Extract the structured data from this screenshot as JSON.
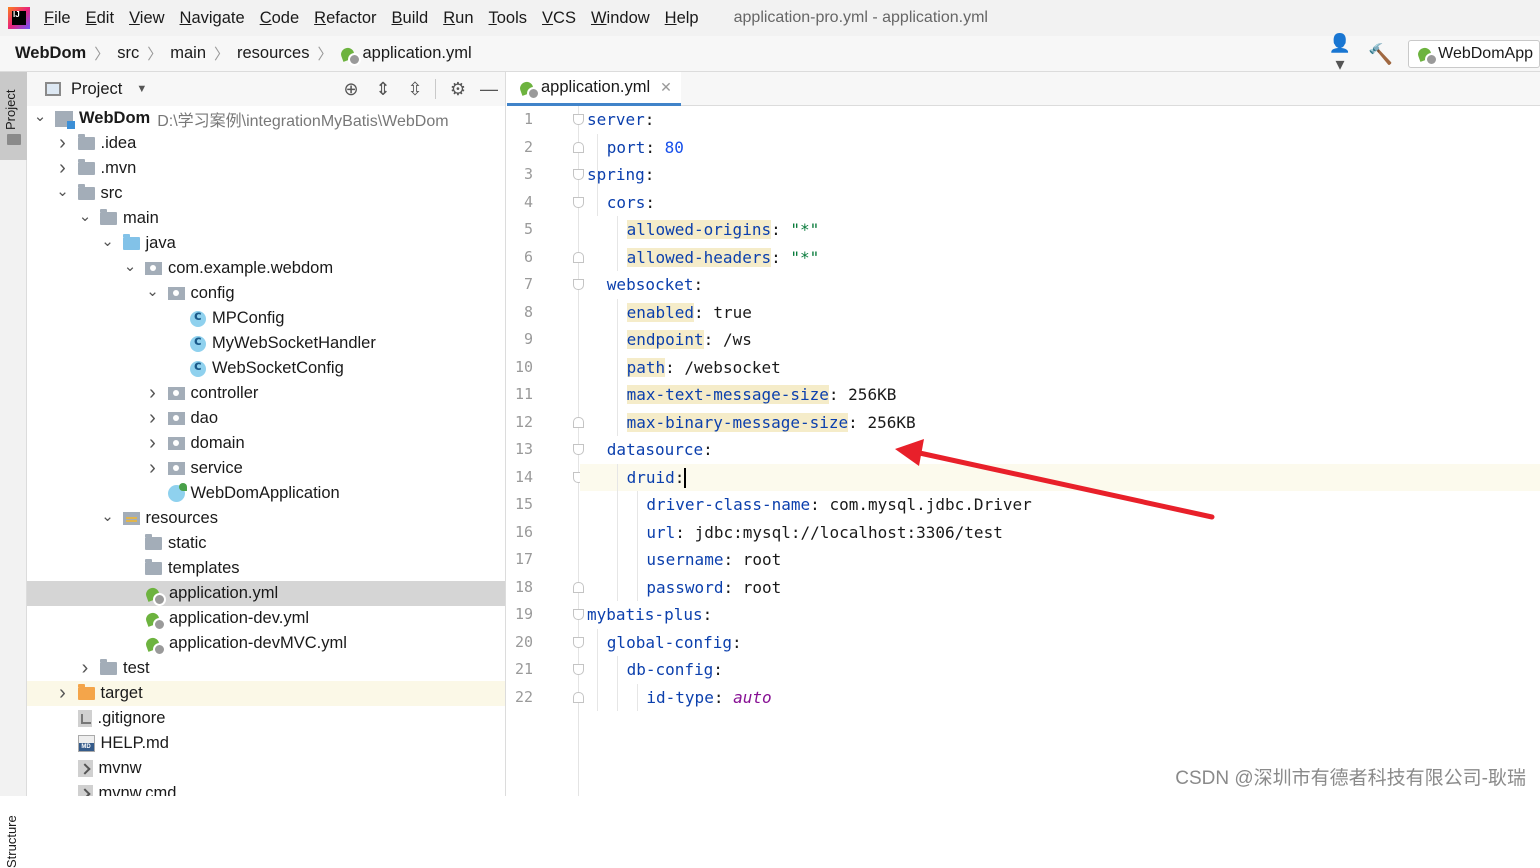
{
  "menubar": {
    "items": [
      {
        "first": "F",
        "rest": "ile"
      },
      {
        "first": "E",
        "rest": "dit"
      },
      {
        "first": "V",
        "rest": "iew"
      },
      {
        "first": "N",
        "rest": "avigate"
      },
      {
        "first": "C",
        "rest": "ode"
      },
      {
        "first": "R",
        "rest": "efactor"
      },
      {
        "first": "B",
        "rest": "uild"
      },
      {
        "first": "R",
        "rest": "un"
      },
      {
        "first": "T",
        "rest": "ools"
      },
      {
        "first": "V",
        "rest": "CS"
      },
      {
        "first": "W",
        "rest": "indow"
      },
      {
        "first": "H",
        "rest": "elp"
      }
    ],
    "window_title": "application-pro.yml - application.yml"
  },
  "breadcrumb": [
    "WebDom",
    "src",
    "main",
    "resources",
    "application.yml"
  ],
  "run_config": "WebDomApp",
  "project_panel": {
    "title": "Project",
    "tools": [
      "crosshair-icon",
      "expand-all-icon",
      "collapse-all-icon",
      "gear-icon",
      "minimize-icon"
    ]
  },
  "tree": [
    {
      "depth": 0,
      "arrow": "down",
      "icon": "module",
      "label": "WebDom",
      "path": "D:\\学习案例\\integrationMyBatis\\WebDom",
      "bold": true
    },
    {
      "depth": 1,
      "arrow": "right",
      "icon": "folder",
      "label": ".idea"
    },
    {
      "depth": 1,
      "arrow": "right",
      "icon": "folder",
      "label": ".mvn"
    },
    {
      "depth": 1,
      "arrow": "down",
      "icon": "folder",
      "label": "src"
    },
    {
      "depth": 2,
      "arrow": "down",
      "icon": "folder",
      "label": "main"
    },
    {
      "depth": 3,
      "arrow": "down",
      "icon": "folder-blue",
      "label": "java"
    },
    {
      "depth": 4,
      "arrow": "down",
      "icon": "package",
      "label": "com.example.webdom"
    },
    {
      "depth": 5,
      "arrow": "down",
      "icon": "package",
      "label": "config"
    },
    {
      "depth": 6,
      "arrow": "none",
      "icon": "class",
      "label": "MPConfig"
    },
    {
      "depth": 6,
      "arrow": "none",
      "icon": "class",
      "label": "MyWebSocketHandler"
    },
    {
      "depth": 6,
      "arrow": "none",
      "icon": "class",
      "label": "WebSocketConfig"
    },
    {
      "depth": 5,
      "arrow": "right",
      "icon": "package",
      "label": "controller"
    },
    {
      "depth": 5,
      "arrow": "right",
      "icon": "package",
      "label": "dao"
    },
    {
      "depth": 5,
      "arrow": "right",
      "icon": "package",
      "label": "domain"
    },
    {
      "depth": 5,
      "arrow": "right",
      "icon": "package",
      "label": "service"
    },
    {
      "depth": 5,
      "arrow": "none",
      "icon": "appclass",
      "label": "WebDomApplication"
    },
    {
      "depth": 3,
      "arrow": "down",
      "icon": "resources",
      "label": "resources"
    },
    {
      "depth": 4,
      "arrow": "none",
      "icon": "folder",
      "label": "static"
    },
    {
      "depth": 4,
      "arrow": "none",
      "icon": "folder",
      "label": "templates"
    },
    {
      "depth": 4,
      "arrow": "none",
      "icon": "yml",
      "label": "application.yml",
      "selected": true
    },
    {
      "depth": 4,
      "arrow": "none",
      "icon": "yml",
      "label": "application-dev.yml"
    },
    {
      "depth": 4,
      "arrow": "none",
      "icon": "yml",
      "label": "application-devMVC.yml"
    },
    {
      "depth": 2,
      "arrow": "right",
      "icon": "folder",
      "label": "test"
    },
    {
      "depth": 1,
      "arrow": "right",
      "icon": "folder-orange",
      "label": "target",
      "highlight": true
    },
    {
      "depth": 1,
      "arrow": "none",
      "icon": "gitignore",
      "label": ".gitignore"
    },
    {
      "depth": 1,
      "arrow": "none",
      "icon": "md",
      "label": "HELP.md"
    },
    {
      "depth": 1,
      "arrow": "none",
      "icon": "script",
      "label": "mvnw"
    },
    {
      "depth": 1,
      "arrow": "none",
      "icon": "script",
      "label": "mvnw.cmd"
    }
  ],
  "side_strip": {
    "project": "Project",
    "structure": "Structure"
  },
  "editor": {
    "tab": "application.yml",
    "current_line": 14,
    "lines": [
      {
        "n": 1,
        "indent": 0,
        "key": "server",
        "value": "",
        "vtype": "",
        "hl": false,
        "fold": "open"
      },
      {
        "n": 2,
        "indent": 1,
        "key": "port",
        "value": "80",
        "vtype": "num",
        "hl": false,
        "fold": "close"
      },
      {
        "n": 3,
        "indent": 0,
        "key": "spring",
        "value": "",
        "vtype": "",
        "hl": false,
        "fold": "open"
      },
      {
        "n": 4,
        "indent": 1,
        "key": "cors",
        "value": "",
        "vtype": "",
        "hl": false,
        "fold": "open"
      },
      {
        "n": 5,
        "indent": 2,
        "key": "allowed-origins",
        "value": "\"*\"",
        "vtype": "str",
        "hl": true,
        "fold": ""
      },
      {
        "n": 6,
        "indent": 2,
        "key": "allowed-headers",
        "value": "\"*\"",
        "vtype": "str",
        "hl": true,
        "fold": "close"
      },
      {
        "n": 7,
        "indent": 1,
        "key": "websocket",
        "value": "",
        "vtype": "",
        "hl": false,
        "fold": "open"
      },
      {
        "n": 8,
        "indent": 2,
        "key": "enabled",
        "value": "true",
        "vtype": "plain",
        "hl": true,
        "fold": ""
      },
      {
        "n": 9,
        "indent": 2,
        "key": "endpoint",
        "value": "/ws",
        "vtype": "plain",
        "hl": true,
        "fold": ""
      },
      {
        "n": 10,
        "indent": 2,
        "key": "path",
        "value": "/websocket",
        "vtype": "plain",
        "hl": true,
        "fold": ""
      },
      {
        "n": 11,
        "indent": 2,
        "key": "max-text-message-size",
        "value": "256KB",
        "vtype": "plain",
        "hl": true,
        "fold": ""
      },
      {
        "n": 12,
        "indent": 2,
        "key": "max-binary-message-size",
        "value": "256KB",
        "vtype": "plain",
        "hl": true,
        "fold": "close"
      },
      {
        "n": 13,
        "indent": 1,
        "key": "datasource",
        "value": "",
        "vtype": "",
        "hl": false,
        "fold": "open"
      },
      {
        "n": 14,
        "indent": 2,
        "key": "druid",
        "value": "",
        "vtype": "",
        "hl": false,
        "fold": "open"
      },
      {
        "n": 15,
        "indent": 3,
        "key": "driver-class-name",
        "value": "com.mysql.jdbc.Driver",
        "vtype": "plain",
        "hl": false,
        "fold": ""
      },
      {
        "n": 16,
        "indent": 3,
        "key": "url",
        "value": "jdbc:mysql://localhost:3306/test",
        "vtype": "plain",
        "hl": false,
        "fold": ""
      },
      {
        "n": 17,
        "indent": 3,
        "key": "username",
        "value": "root",
        "vtype": "plain",
        "hl": false,
        "fold": ""
      },
      {
        "n": 18,
        "indent": 3,
        "key": "password",
        "value": "root",
        "vtype": "plain",
        "hl": false,
        "fold": "close"
      },
      {
        "n": 19,
        "indent": 0,
        "key": "mybatis-plus",
        "value": "",
        "vtype": "",
        "hl": false,
        "fold": "open"
      },
      {
        "n": 20,
        "indent": 1,
        "key": "global-config",
        "value": "",
        "vtype": "",
        "hl": false,
        "fold": "open"
      },
      {
        "n": 21,
        "indent": 2,
        "key": "db-config",
        "value": "",
        "vtype": "",
        "hl": false,
        "fold": "open"
      },
      {
        "n": 22,
        "indent": 3,
        "key": "id-type",
        "value": "auto",
        "vtype": "kw",
        "hl": false,
        "fold": "close"
      }
    ]
  },
  "annotation": {
    "color": "#e8202a"
  },
  "watermark": "CSDN @深圳市有德者科技有限公司-耿瑞"
}
